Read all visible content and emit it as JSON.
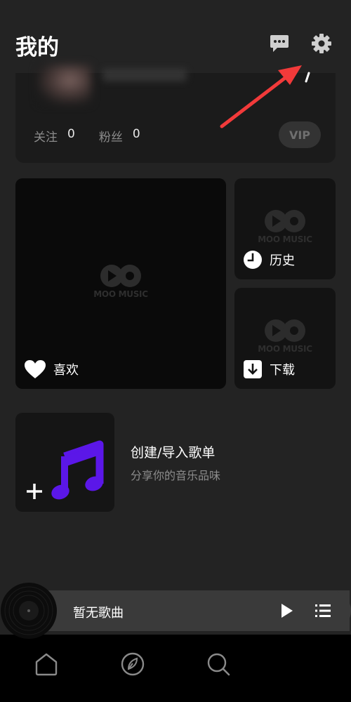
{
  "header": {
    "title": "我的",
    "message_icon": "message-icon",
    "settings_icon": "gear-icon"
  },
  "profile": {
    "follow_label": "关注",
    "follow_count": "0",
    "fans_label": "粉丝",
    "fans_count": "0",
    "vip_label": "VIP"
  },
  "tiles": {
    "logo_text": "MOO MUSIC",
    "like_label": "喜欢",
    "history_label": "历史",
    "download_label": "下载"
  },
  "playlist": {
    "create_title": "创建/导入歌单",
    "create_subtitle": "分享你的音乐品味",
    "accent_color": "#5b17e8"
  },
  "player": {
    "song_title": "暂无歌曲"
  },
  "nav": {
    "items": [
      "home-icon",
      "explore-icon",
      "search-icon"
    ]
  },
  "annotation": {
    "arrow_color": "#f23a3a"
  }
}
